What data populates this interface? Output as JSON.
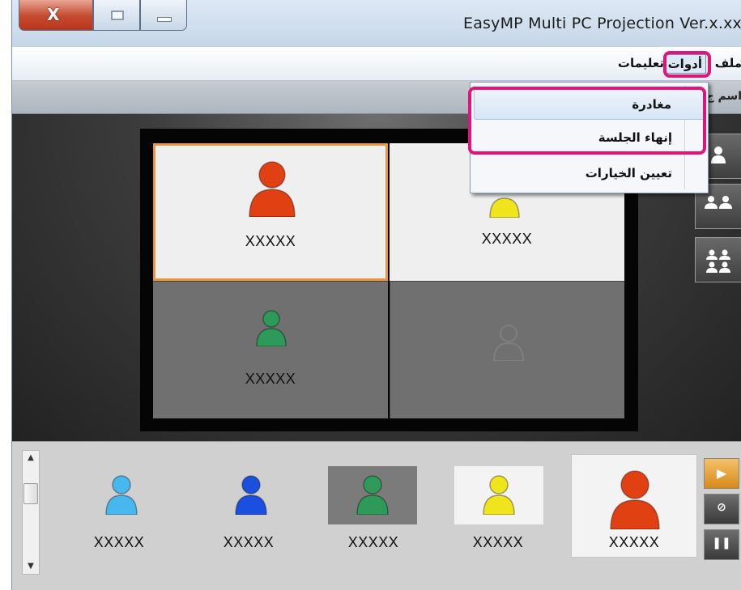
{
  "window": {
    "title": "EasyMP Multi PC Projection Ver.x.xx",
    "close_glyph": "X"
  },
  "menu": {
    "file": "ملف",
    "tools": "أدوات",
    "help": "تعليمات"
  },
  "info": {
    "label": "اسم ج"
  },
  "dropdown": {
    "items": [
      {
        "label": "مغادرة"
      },
      {
        "label": "إنهاء الجلسة"
      },
      {
        "label": "تعيين الخيارات"
      }
    ]
  },
  "projection": {
    "cells": [
      {
        "label": "XXXXX",
        "user_color": "#e04012"
      },
      {
        "label": "XXXXX",
        "user_color": "#f0e41c"
      },
      {
        "label": "XXXXX",
        "user_color": "#2e9a5a"
      },
      {
        "label": "",
        "user_color": "#8a8a8a"
      }
    ]
  },
  "layout_buttons": {
    "single_icon": "person-icon",
    "double_icon": "two-persons-icon",
    "quad_icon": "four-persons-icon"
  },
  "thumbnails": [
    {
      "label": "XXXXX",
      "user_color": "#47b8ee"
    },
    {
      "label": "XXXXX",
      "user_color": "#1a4fe0"
    },
    {
      "label": "XXXXX",
      "user_color": "#2e9a5a"
    },
    {
      "label": "XXXXX",
      "user_color": "#f0e41c"
    }
  ],
  "presenter": {
    "label": "XXXXX",
    "user_color": "#e04012"
  },
  "controls": {
    "play_glyph": "▶",
    "mute_glyph": "⊘",
    "pause_glyph": "❚❚"
  },
  "highlight_color": "#e0157a"
}
